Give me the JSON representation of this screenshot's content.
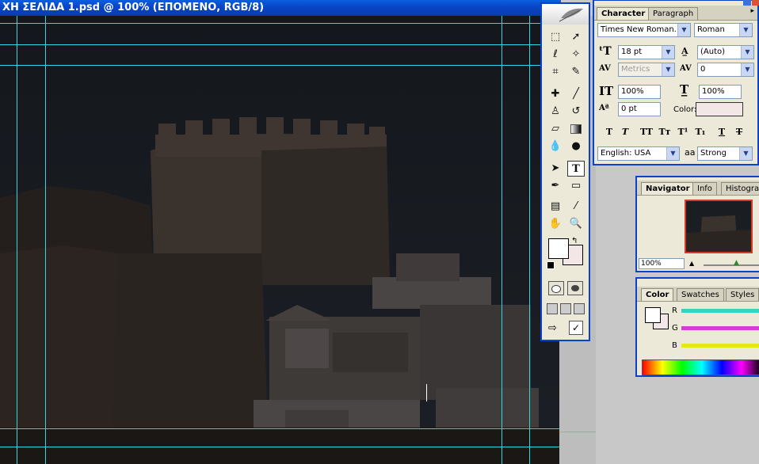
{
  "document": {
    "title": "ΧΗ ΣΕΛΙΔΑ 1.psd @ 100% (ΕΠΟΜΕΝΟ, RGB/8)"
  },
  "toolbox": {
    "tools": [
      "marquee",
      "move",
      "lasso",
      "magic-wand",
      "crop",
      "slice",
      "healing-brush",
      "brush",
      "clone-stamp",
      "history-brush",
      "eraser",
      "gradient",
      "blur",
      "dodge",
      "path-selection",
      "type",
      "pen",
      "rectangle",
      "notes",
      "eyedropper",
      "hand",
      "zoom"
    ],
    "foreground_color": "#ffffff",
    "background_color": "#f3e6e6"
  },
  "character_panel": {
    "tabs": [
      "Character",
      "Paragraph"
    ],
    "font_family": "Times New Roman...",
    "font_style": "Roman",
    "font_size": "18 pt",
    "leading": "(Auto)",
    "kerning": "Metrics",
    "tracking": "0",
    "vertical_scale": "100%",
    "horizontal_scale": "100%",
    "baseline_shift": "0 pt",
    "color_label": "Color:",
    "style_buttons": [
      "T",
      "T",
      "TT",
      "Tт",
      "T¹",
      "T₁",
      "T",
      "T"
    ],
    "language": "English: USA",
    "aa_icon": "aa",
    "antialias": "Strong"
  },
  "navigator_panel": {
    "tabs": [
      "Navigator",
      "Info",
      "Histogra"
    ],
    "zoom": "100%"
  },
  "color_panel": {
    "tabs": [
      "Color",
      "Swatches",
      "Styles"
    ],
    "channels": [
      "R",
      "G",
      "B"
    ],
    "colors": {
      "R": "#2fd6c8",
      "G": "#d63bd6",
      "B": "#e6e61a"
    }
  }
}
